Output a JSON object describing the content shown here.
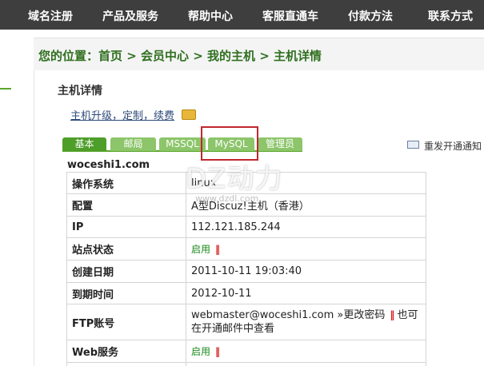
{
  "nav": {
    "items": [
      {
        "label": "域名注册"
      },
      {
        "label": "产品及服务"
      },
      {
        "label": "帮助中心"
      },
      {
        "label": "客服直通车"
      },
      {
        "label": "付款方法"
      },
      {
        "label": "联系方式"
      }
    ]
  },
  "breadcrumb": {
    "text": "您的位置：首页 > 会员中心 > 我的主机 > 主机详情"
  },
  "panel": {
    "title": "主机详情",
    "upgrade_link": "主机升级，定制，续费"
  },
  "tabs": [
    {
      "label": "基本"
    },
    {
      "label": "邮局"
    },
    {
      "label": "MSSQL"
    },
    {
      "label": "MySQL"
    },
    {
      "label": "管理员"
    }
  ],
  "resend_notice": "重发开通通知",
  "domain": "woceshi1.com",
  "info_rows": [
    {
      "label": "操作系统",
      "value": "linux"
    },
    {
      "label": "配置",
      "value": "A型Discuz!主机（香港）"
    },
    {
      "label": "IP",
      "value": "112.121.185.244"
    },
    {
      "label": "站点状态",
      "value": "启用",
      "marker": "‖"
    },
    {
      "label": "创建日期",
      "value": "2011-10-11 19:03:40"
    },
    {
      "label": "到期时间",
      "value": "2012-10-11"
    },
    {
      "label": "FTP账号",
      "value": "webmaster@woceshi1.com",
      "link": "»更改密码",
      "marker": "‖",
      "note": "也可在开通邮件中查看"
    },
    {
      "label": "Web服务",
      "value": "启用",
      "marker": "‖"
    }
  ],
  "watermark": {
    "text": "DZ动力",
    "sub": "www.dzdl.com"
  },
  "colors": {
    "nav_bg": "#3e3e3e",
    "accent_green": "#5aa52b",
    "breadcrumb_green": "#2f6f1f",
    "highlight_red": "#c0272d"
  }
}
